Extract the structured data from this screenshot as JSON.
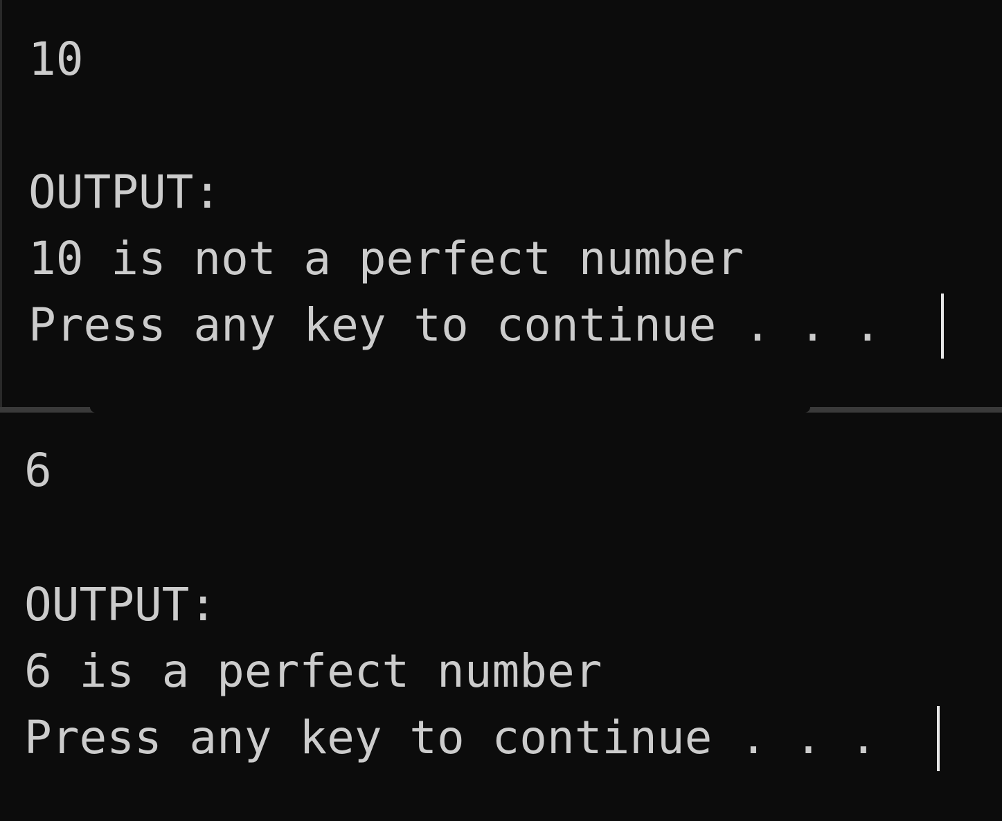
{
  "sessions": [
    {
      "input_value": "10",
      "output_heading": "OUTPUT:",
      "result_text": "10 is not a perfect number",
      "prompt_text": "Press any key to continue . . ."
    },
    {
      "input_value": "6",
      "output_heading": "OUTPUT:",
      "result_text": "6 is a perfect number",
      "prompt_text": "Press any key to continue . . ."
    }
  ],
  "colors": {
    "background": "#0c0c0c",
    "text": "#cccccc",
    "frame": "#3a3a3a"
  }
}
